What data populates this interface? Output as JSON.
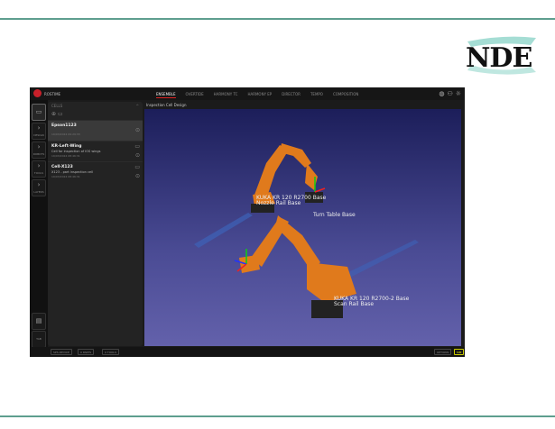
{
  "slide": {
    "logo_text": "NDE",
    "accent": "#5e9e8e"
  },
  "app": {
    "brand": "ROSTIME",
    "tabs": [
      {
        "label": "ENSEMBLE",
        "active": true
      },
      {
        "label": "OVERTIDE"
      },
      {
        "label": "HARMONY TC"
      },
      {
        "label": "HARMONY EP"
      },
      {
        "label": "DIRECTOR"
      },
      {
        "label": "TEMPO"
      },
      {
        "label": "COMPOSITION"
      }
    ],
    "top_icons": [
      "globe-icon",
      "user-icon",
      "settings-icon"
    ],
    "rail": [
      {
        "label": "DESIGN"
      },
      {
        "label": "ROBOTS"
      },
      {
        "label": "TOOLS"
      },
      {
        "label": "LAYERS"
      }
    ],
    "rail_bottom": "TAB MENU",
    "cells": {
      "header": "CELLS",
      "items": [
        {
          "name": "Epson1123",
          "desc": "",
          "date": "19/03/2024 09:29:33",
          "selected": true
        },
        {
          "name": "KR-Left-Wing",
          "desc": "Cell for inspection of IOS wings",
          "date": "19/03/2024 08:46:31"
        },
        {
          "name": "Cell-X123",
          "desc": "X123 - part inspection cell",
          "date": "19/03/2024 08:46:31"
        }
      ]
    },
    "viewport": {
      "title": "Inspection Cell Design",
      "labels": [
        "KUKA KR 120 R2700 Base",
        "Nozzle Rail Base",
        "Turn Table Base",
        "KUKA KR 120 R2700-2 Base",
        "Scan Rail Base"
      ]
    },
    "status": {
      "items": [
        "SPS-DEVICE",
        "0 PARTS",
        "0 TOOLS"
      ],
      "options": "OPTIONS",
      "sim": "SIM"
    }
  }
}
